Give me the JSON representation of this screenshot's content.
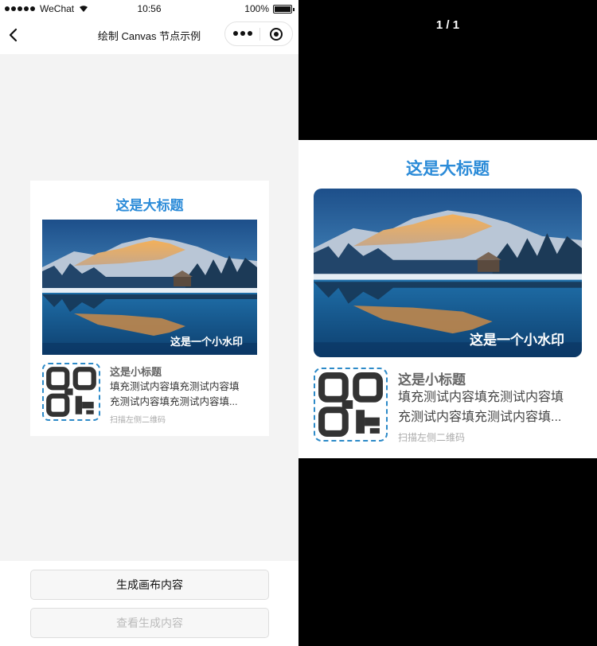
{
  "status_bar": {
    "carrier": "WeChat",
    "time": "10:56",
    "battery": "100%"
  },
  "navbar": {
    "title": "绘制 Canvas 节点示例"
  },
  "card": {
    "title": "这是大标题",
    "watermark": "这是一个小水印",
    "subtitle": "这是小标题",
    "desc_line1": "填充测试内容填充测试内容填",
    "desc_line2": "充测试内容填充测试内容填...",
    "hint": "扫描左侧二维码"
  },
  "buttons": {
    "generate": "生成画布内容",
    "view": "查看生成内容"
  },
  "preview": {
    "counter": "1 / 1",
    "title": "这是大标题",
    "watermark": "这是一个小水印",
    "subtitle": "这是小标题",
    "desc_line1": "填充测试内容填充测试内容填",
    "desc_line2": "充测试内容填充测试内容填...",
    "hint": "扫描左侧二维码"
  },
  "colors": {
    "accent": "#2b8bd8",
    "qr_border": "#2d8ac8"
  },
  "icons": [
    "back-icon",
    "more-icon",
    "target-icon",
    "wifi-icon",
    "battery-icon"
  ]
}
